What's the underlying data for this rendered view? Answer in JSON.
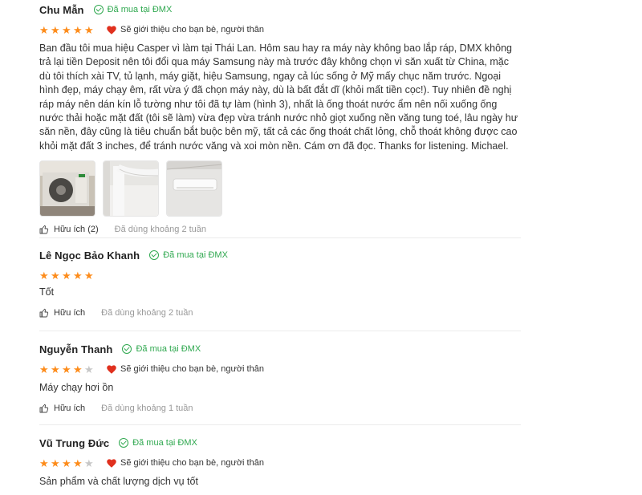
{
  "reviews": [
    {
      "author": "Chu Mẫn",
      "verified": "Đã mua tại ĐMX",
      "rating": 5,
      "recommend": "Sẽ giới thiệu cho bạn bè, người thân",
      "content": "Ban đầu tôi mua hiệu Casper vì làm tại Thái Lan. Hôm sau hay ra máy này không bao lắp ráp, DMX không trả lại tiền Deposit nên tôi đổi qua máy Samsung này mà trước đây không chọn vì săn xuất từ China, mặc dù tôi thích xài TV, tủ lạnh, máy giặt, hiệu Samsung, ngay cả lúc sống ở Mỹ mấy chục năm trước. Ngoại hình đẹp, máy chạy êm, rất vừa ý đã chọn máy này, dù là bất đắt dĩ (khỏi mất tiền cọc!). Tuy nhiên đề nghị ráp máy nên dán kín lỗ tường như tôi đã tự làm (hình 3), nhất là ống thoát nước ẩm nên nối xuống ống nước thải hoặc mặt đất (tôi sẽ làm) vừa đẹp vừa tránh nước nhỏ giọt xuống nền văng tung toé, lâu ngày hư săn nền, đây cũng là tiêu chuẩn bắt buộc bên mỹ, tất cả các ống thoát chất lỏng, chỗ thoát không được cao khỏi mặt đất 3 inches, để tránh nước văng và xoi mòn nền. Cám ơn đã đọc. Thanks for listening. Michael.",
      "images": [
        "outdoor-unit-photo",
        "indoor-pipe-photo",
        "indoor-unit-photo"
      ],
      "helpful": "Hữu ích (2)",
      "usage": "Đã dùng khoảng 2 tuần"
    },
    {
      "author": "Lê Ngọc Bảo Khanh",
      "verified": "Đã mua tại ĐMX",
      "rating": 5,
      "content": "Tốt",
      "helpful": "Hữu ích",
      "usage": "Đã dùng khoảng 2 tuần"
    },
    {
      "author": "Nguyễn Thanh",
      "verified": "Đã mua tại ĐMX",
      "rating": 4,
      "recommend": "Sẽ giới thiệu cho bạn bè, người thân",
      "content": "Máy chạy hơi ồn",
      "helpful": "Hữu ích",
      "usage": "Đã dùng khoảng 1 tuần"
    },
    {
      "author": "Vũ Trung Đức",
      "verified": "Đã mua tại ĐMX",
      "rating": 4,
      "recommend": "Sẽ giới thiệu cho bạn bè, người thân",
      "content": "Sản phẩm và chất lượng dịch vụ tốt"
    }
  ],
  "colors": {
    "star": "#fd8c1b",
    "star_off": "#c7c7c7",
    "verified": "#2fa84f",
    "heart": "#e0301e",
    "muted": "#999999"
  },
  "icons": {
    "verified": "check-circle-icon",
    "recommend": "heart-icon",
    "helpful": "thumbs-up-icon",
    "star": "star-icon"
  }
}
